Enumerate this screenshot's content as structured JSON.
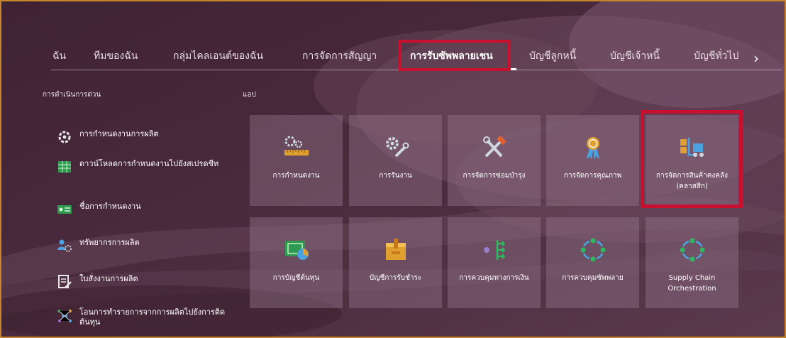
{
  "tabs": [
    {
      "label": "ฉัน",
      "active": false
    },
    {
      "label": "ทีมของฉัน",
      "active": false
    },
    {
      "label": "กลุ่มไคลเอนต์ของฉัน",
      "active": false
    },
    {
      "label": "การจัดการสัญญา",
      "active": false
    },
    {
      "label": "การรับซัพพลายเชน",
      "active": true
    },
    {
      "label": "บัญชีลูกหนี้",
      "active": false
    },
    {
      "label": "บัญชีเจ้าหนี้",
      "active": false
    },
    {
      "label": "บัญชีทั่วไป",
      "active": false
    }
  ],
  "tab_next_icon": "›",
  "quick_actions": {
    "title": "การดำเนินการด่วน",
    "items": [
      {
        "label": "การกำหนดงานการผลิต",
        "icon": "settings-gear-icon"
      },
      {
        "label": "ดาวน์โหลดการกำหนดงานไปยังสเปรดชีท",
        "icon": "spreadsheet-icon"
      },
      {
        "label": "ชื่อการกำหนดงาน",
        "icon": "id-card-icon"
      },
      {
        "label": "ทรัพยากรการผลิต",
        "icon": "people-gear-icon"
      },
      {
        "label": "ใบสั่งงานการผลิต",
        "icon": "document-pencil-icon"
      },
      {
        "label": "โอนการทำรายการจากการผลิตไปยังการติดต้นทุน",
        "icon": "network-icon"
      }
    ]
  },
  "apps": {
    "title": "แอป",
    "tiles": [
      {
        "label": "การกำหนดงาน",
        "icon": "gear-ruler-icon"
      },
      {
        "label": "การรันงาน",
        "icon": "gears-wrench-icon"
      },
      {
        "label": "การจัดการซ่อมบำรุง",
        "icon": "hammer-wrench-icon"
      },
      {
        "label": "การจัดการคุณภาพ",
        "icon": "award-ribbon-icon"
      },
      {
        "label": "การจัดการสินค้าคงคลัง (คลาสสิก)",
        "icon": "forklift-icon"
      },
      {
        "label": "การบัญชีต้นทุน",
        "icon": "cost-chart-icon"
      },
      {
        "label": "บัญชีการรับชำระ",
        "icon": "box-icon"
      },
      {
        "label": "การควบคุมทางการเงิน",
        "icon": "branch-arrows-icon"
      },
      {
        "label": "การควบคุมซัพพลาย",
        "icon": "cycle-arrows-icon"
      },
      {
        "label": "Supply Chain Orchestration",
        "icon": "cycle-arrows-icon"
      }
    ]
  },
  "colors": {
    "background": "#4a2b3d",
    "highlight": "#c8102e",
    "frame": "#c8842a"
  }
}
